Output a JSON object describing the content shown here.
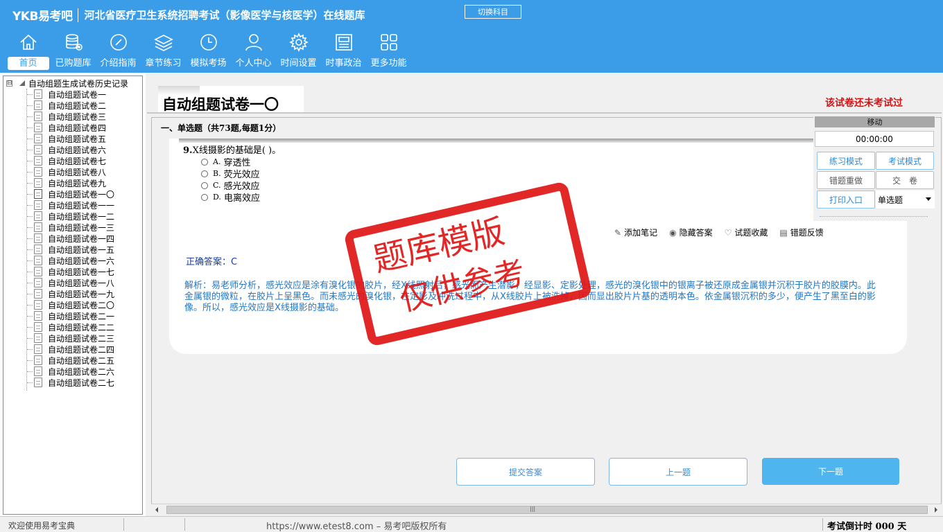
{
  "header": {
    "logo": "YKB易考吧",
    "title": "河北省医疗卫生系统招聘考试（影像医学与核医学）在线题库",
    "switch_label": "切换科目",
    "nav": [
      {
        "label": "首页",
        "icon": "home-icon",
        "active": true
      },
      {
        "label": "已购题库",
        "icon": "database-add-icon"
      },
      {
        "label": "介绍指南",
        "icon": "compass-icon"
      },
      {
        "label": "章节练习",
        "icon": "layers-icon"
      },
      {
        "label": "模拟考场",
        "icon": "clock-icon"
      },
      {
        "label": "个人中心",
        "icon": "user-icon"
      },
      {
        "label": "时间设置",
        "icon": "gear-icon"
      },
      {
        "label": "时事政治",
        "icon": "newspaper-icon"
      },
      {
        "label": "更多功能",
        "icon": "grid-icon"
      }
    ]
  },
  "tree": {
    "expander": "⊟",
    "root": "自动组题生成试卷历史记录",
    "items": [
      "自动组题试卷一",
      "自动组题试卷二",
      "自动组题试卷三",
      "自动组题试卷四",
      "自动组题试卷五",
      "自动组题试卷六",
      "自动组题试卷七",
      "自动组题试卷八",
      "自动组题试卷九",
      "自动组题试卷一〇",
      "自动组题试卷一一",
      "自动组题试卷一二",
      "自动组题试卷一三",
      "自动组题试卷一四",
      "自动组题试卷一五",
      "自动组题试卷一六",
      "自动组题试卷一七",
      "自动组题试卷一八",
      "自动组题试卷一九",
      "自动组题试卷二〇",
      "自动组题试卷二一",
      "自动组题试卷二二",
      "自动组题试卷二三",
      "自动组题试卷二四",
      "自动组题试卷二五",
      "自动组题试卷二六",
      "自动组题试卷二七"
    ]
  },
  "paper": {
    "title": "自动组题试卷一〇",
    "status": "该试卷还未考试过",
    "section": "一、单选题（共73题,每题1分）"
  },
  "question": {
    "number": "9.",
    "text": "X线摄影的基础是( )。",
    "options": [
      {
        "key": "A.",
        "text": "穿透性"
      },
      {
        "key": "B.",
        "text": "荧光效应"
      },
      {
        "key": "C.",
        "text": "感光效应"
      },
      {
        "key": "D.",
        "text": "电离效应"
      }
    ],
    "actions": [
      {
        "icon": "pencil-icon",
        "glyph": "✎",
        "label": "添加笔记"
      },
      {
        "icon": "eye-icon",
        "glyph": "◉",
        "label": "隐藏答案"
      },
      {
        "icon": "heart-icon",
        "glyph": "♡",
        "label": "试题收藏"
      },
      {
        "icon": "report-icon",
        "glyph": "▤",
        "label": "错题反馈"
      }
    ],
    "answer": "正确答案：C",
    "analysis": "解析：易老师分析，感光效应是涂有溴化银的胶片，经X线照射后，感光而产生潜影，经显影、定影处理，感光的溴化银中的银离子被还原成金属银并沉积于胶片的胶膜内。此金属银的微粒，在胶片上呈黑色。而未感光的溴化银，在定影及冲洗过程中，从X线胶片上被洗掉，因而显出胶片片基的透明本色。依金属银沉积的多少，便产生了黑至白的影像。所以，感光效应是X线摄影的基础。"
  },
  "control": {
    "move_label": "移动",
    "timer": "00:00:00",
    "practice_mode": "练习模式",
    "exam_mode": "考试模式",
    "redo_wrong": "错题重做",
    "submit_paper": "交　卷",
    "print_entry": "打印入口",
    "question_type": "单选题"
  },
  "buttons": {
    "submit": "提交答案",
    "prev": "上一题",
    "next": "下一题"
  },
  "statusbar": {
    "welcome": "欢迎使用易考宝典",
    "url": "https://www.etest8.com – 易考吧版权所有",
    "countdown": "考试倒计时 000 天"
  },
  "watermark": {
    "line1": "题库模版",
    "line2": "仅供参考"
  },
  "colors": {
    "header_bg": "#3b9de8",
    "stamp_red": "#e01515",
    "answer_blue": "#1a3d9c",
    "analysis_blue": "#2477c5"
  }
}
